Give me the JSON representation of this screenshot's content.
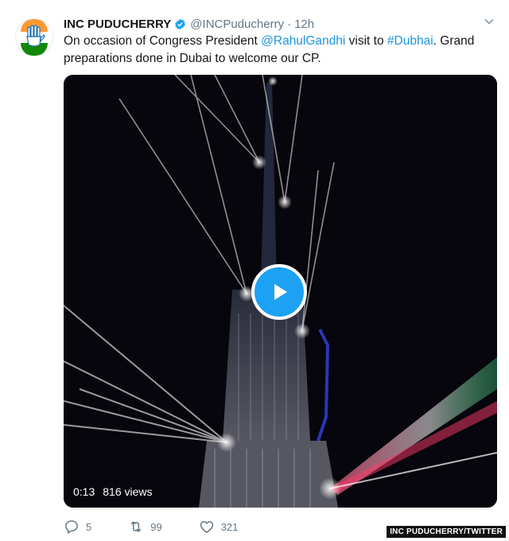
{
  "tweet": {
    "display_name": "INC PUDUCHERRY",
    "handle": "@INCPuducherry",
    "separator": "·",
    "time": "12h",
    "text": {
      "part1": "On occasion of Congress President ",
      "mention": "@RahulGandhi",
      "part2": " visit to ",
      "hashtag": "#Dubhai",
      "part3": ". Grand preparations done in Dubai to welcome our CP."
    }
  },
  "video": {
    "duration": "0:13",
    "views": "816 views"
  },
  "actions": {
    "replies": "5",
    "retweets": "99",
    "likes": "321"
  },
  "credit": "INC PUDUCHERRY/TWITTER",
  "colors": {
    "link": "#1b95e0",
    "play": "#1da1f2",
    "muted": "#657786"
  },
  "icons": [
    "congress-hand-logo",
    "verified-badge-icon",
    "chevron-down-icon",
    "play-icon",
    "reply-icon",
    "retweet-icon",
    "like-icon"
  ]
}
